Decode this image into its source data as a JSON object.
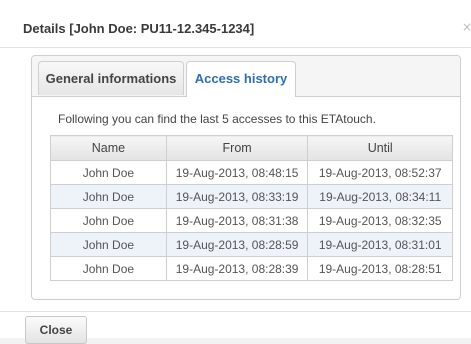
{
  "dialog": {
    "title": "Details [John Doe: PU11-12.345-1234]",
    "close_glyph": "×"
  },
  "tabs": [
    {
      "label": "General informations",
      "active": false
    },
    {
      "label": "Access history",
      "active": true
    }
  ],
  "access_history": {
    "intro": "Following you can find the last 5 accesses to this ETAtouch.",
    "columns": [
      "Name",
      "From",
      "Until"
    ],
    "rows": [
      {
        "name": "John Doe",
        "from": "19-Aug-2013, 08:48:15",
        "until": "19-Aug-2013, 08:52:37"
      },
      {
        "name": "John Doe",
        "from": "19-Aug-2013, 08:33:19",
        "until": "19-Aug-2013, 08:34:11"
      },
      {
        "name": "John Doe",
        "from": "19-Aug-2013, 08:31:38",
        "until": "19-Aug-2013, 08:32:35"
      },
      {
        "name": "John Doe",
        "from": "19-Aug-2013, 08:28:59",
        "until": "19-Aug-2013, 08:31:01"
      },
      {
        "name": "John Doe",
        "from": "19-Aug-2013, 08:28:39",
        "until": "19-Aug-2013, 08:28:51"
      }
    ]
  },
  "footer": {
    "close_label": "Close"
  },
  "colors": {
    "active_tab_text": "#2e6fb3",
    "alt_row": "#eef2f9",
    "border": "#cfcfcf"
  }
}
